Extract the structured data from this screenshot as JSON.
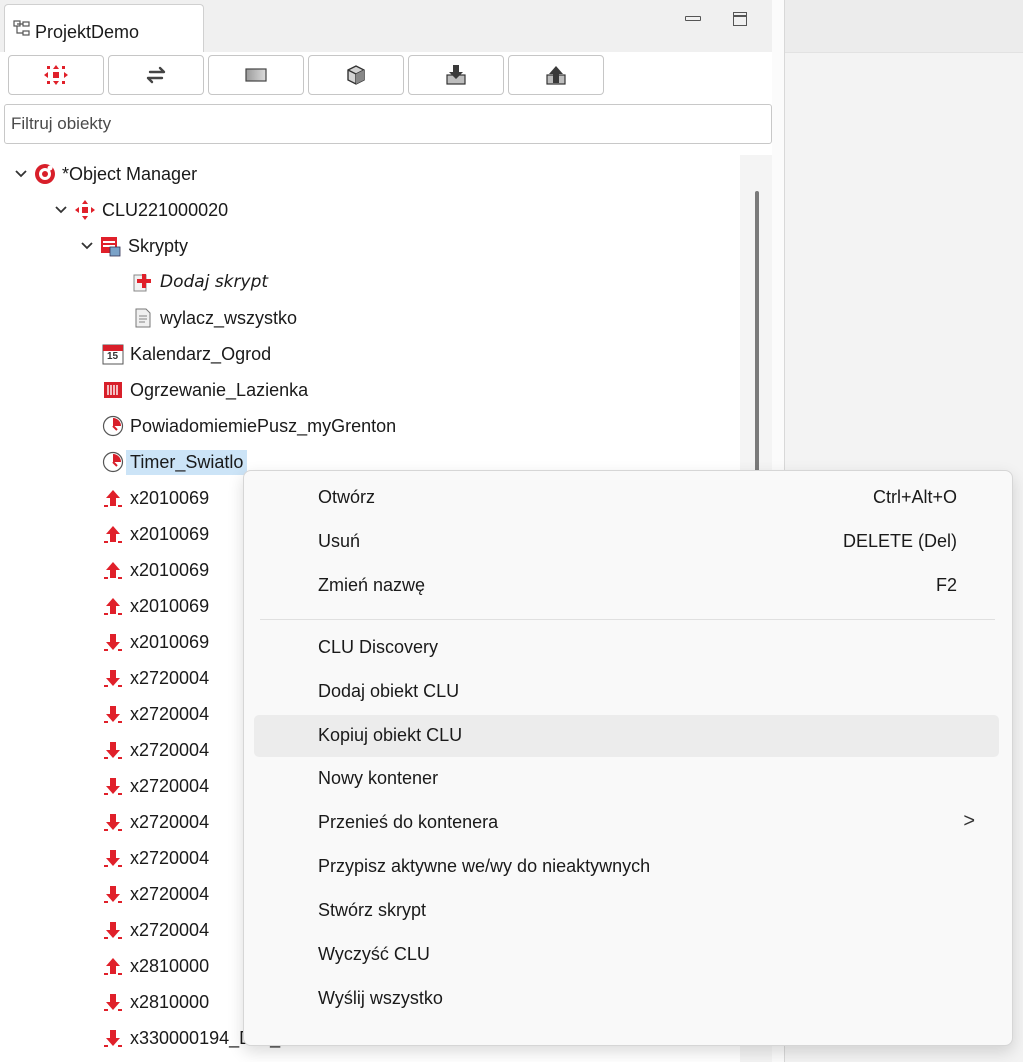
{
  "tab": {
    "title": "ProjektDemo"
  },
  "filter": {
    "placeholder": "Filtruj obiekty"
  },
  "toolbar": {
    "buttons": [
      {
        "icon": "clu-icon"
      },
      {
        "icon": "swap-arrows-icon"
      },
      {
        "icon": "panel-icon"
      },
      {
        "icon": "box-icon"
      },
      {
        "icon": "download-arrow-icon"
      },
      {
        "icon": "upload-arrow-icon"
      }
    ]
  },
  "tree": {
    "items": [
      {
        "label": "*Object Manager",
        "icon": "object-manager-icon",
        "expanded": true
      },
      {
        "label": "CLU221000020",
        "icon": "clu-icon",
        "expanded": true
      },
      {
        "label": "Skrypty",
        "icon": "scripts-folder-icon",
        "expanded": true
      },
      {
        "label": "Dodaj skrypt",
        "icon": "add-script-icon"
      },
      {
        "label": "wylacz_wszystko",
        "icon": "script-file-icon"
      },
      {
        "label": "Kalendarz_Ogrod",
        "icon": "calendar-icon",
        "calendar_day": "15"
      },
      {
        "label": "Ogrzewanie_Lazienka",
        "icon": "heating-icon"
      },
      {
        "label": "PowiadomiemiePusz_myGrenton",
        "icon": "timer-icon"
      },
      {
        "label": "Timer_Swiatlo",
        "icon": "timer-icon",
        "selected": true
      },
      {
        "label": "x2010069",
        "icon": "output-arrow-up-icon"
      },
      {
        "label": "x2010069",
        "icon": "output-arrow-up-icon"
      },
      {
        "label": "x2010069",
        "icon": "output-arrow-up-icon"
      },
      {
        "label": "x2010069",
        "icon": "output-arrow-up-icon"
      },
      {
        "label": "x2010069",
        "icon": "input-arrow-down-icon"
      },
      {
        "label": "x2720004",
        "icon": "input-arrow-down-icon"
      },
      {
        "label": "x2720004",
        "icon": "input-arrow-down-icon"
      },
      {
        "label": "x2720004",
        "icon": "input-arrow-down-icon"
      },
      {
        "label": "x2720004",
        "icon": "input-arrow-down-icon"
      },
      {
        "label": "x2720004",
        "icon": "input-arrow-down-icon"
      },
      {
        "label": "x2720004",
        "icon": "input-arrow-down-icon"
      },
      {
        "label": "x2720004",
        "icon": "input-arrow-down-icon"
      },
      {
        "label": "x2720004",
        "icon": "input-arrow-down-icon"
      },
      {
        "label": "x2810000",
        "icon": "output-arrow-up-icon"
      },
      {
        "label": "x2810000",
        "icon": "input-arrow-down-icon"
      },
      {
        "label": "x330000194_DIN_01",
        "icon": "input-arrow-down-icon"
      }
    ]
  },
  "context_menu": {
    "items": [
      {
        "label": "Otwórz",
        "shortcut": "Ctrl+Alt+O"
      },
      {
        "label": "Usuń",
        "shortcut": "DELETE (Del)"
      },
      {
        "label": "Zmień nazwę",
        "shortcut": "F2"
      },
      {
        "label": "CLU Discovery"
      },
      {
        "label": "Dodaj obiekt CLU"
      },
      {
        "label": "Kopiuj obiekt CLU",
        "highlighted": true
      },
      {
        "label": "Nowy kontener"
      },
      {
        "label": "Przenieś do kontenera",
        "submenu": true
      },
      {
        "label": "Przypisz aktywne we/wy do nieaktywnych"
      },
      {
        "label": "Stwórz skrypt"
      },
      {
        "label": "Wyczyść CLU"
      },
      {
        "label": "Wyślij wszystko"
      }
    ],
    "submenu_arrow": ">"
  },
  "colors": {
    "accent_red": "#e0202a",
    "selection": "#cce4f7",
    "menu_hover": "#ececec"
  }
}
